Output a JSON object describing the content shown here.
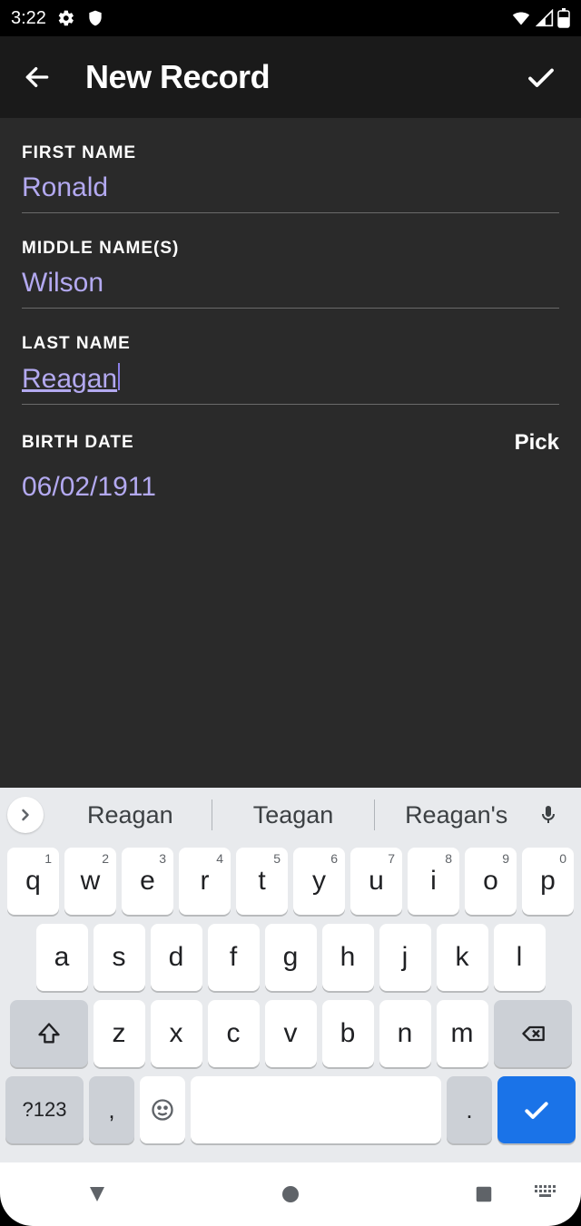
{
  "status": {
    "time": "3:22"
  },
  "header": {
    "title": "New Record"
  },
  "form": {
    "first_name": {
      "label": "FIRST NAME",
      "value": "Ronald"
    },
    "middle_names": {
      "label": "MIDDLE NAME(S)",
      "value": "Wilson"
    },
    "last_name": {
      "label": "LAST NAME",
      "value": "Reagan"
    },
    "birth_date": {
      "label": "BIRTH DATE",
      "pick": "Pick",
      "value": "06/02/1911"
    }
  },
  "keyboard": {
    "suggestions": [
      "Reagan",
      "Teagan",
      "Reagan's"
    ],
    "row1": [
      {
        "k": "q",
        "n": "1"
      },
      {
        "k": "w",
        "n": "2"
      },
      {
        "k": "e",
        "n": "3"
      },
      {
        "k": "r",
        "n": "4"
      },
      {
        "k": "t",
        "n": "5"
      },
      {
        "k": "y",
        "n": "6"
      },
      {
        "k": "u",
        "n": "7"
      },
      {
        "k": "i",
        "n": "8"
      },
      {
        "k": "o",
        "n": "9"
      },
      {
        "k": "p",
        "n": "0"
      }
    ],
    "row2": [
      "a",
      "s",
      "d",
      "f",
      "g",
      "h",
      "j",
      "k",
      "l"
    ],
    "row3": [
      "z",
      "x",
      "c",
      "v",
      "b",
      "n",
      "m"
    ],
    "switch": "?123",
    "comma": ",",
    "period": "."
  }
}
